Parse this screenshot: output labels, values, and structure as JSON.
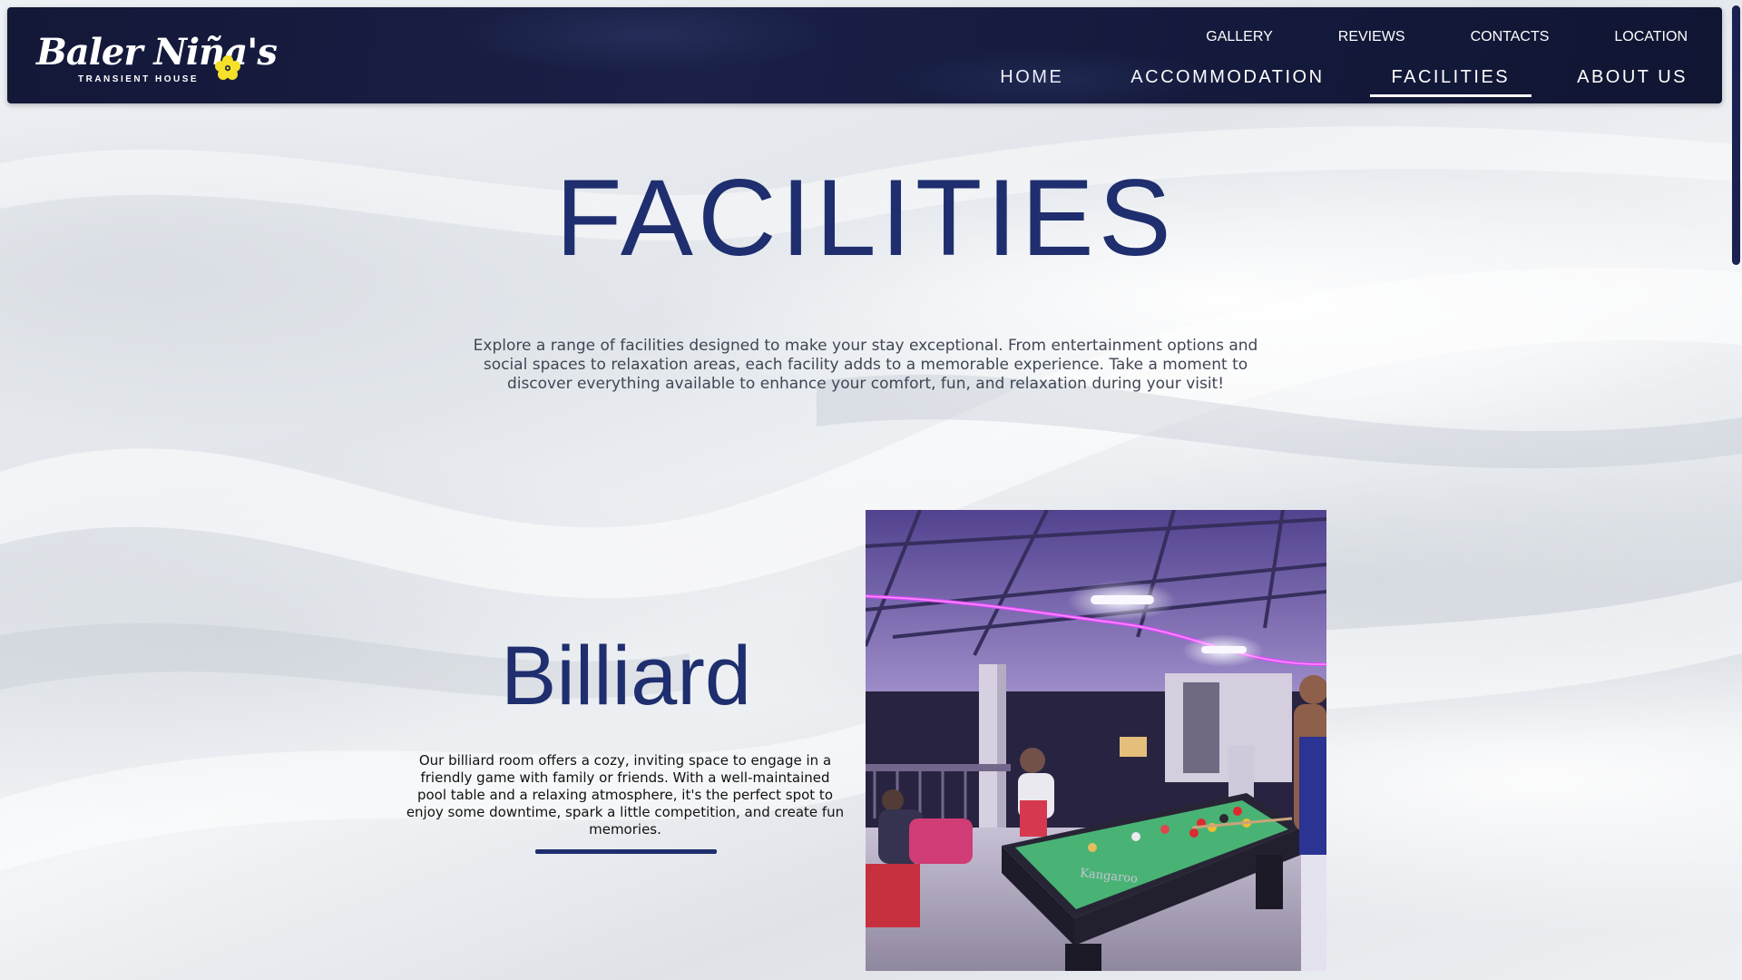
{
  "brand": {
    "name": "Baler Niña's",
    "tagline": "TRANSIENT HOUSE"
  },
  "nav": {
    "top": [
      "GALLERY",
      "REVIEWS",
      "CONTACTS",
      "LOCATION"
    ],
    "main": [
      "HOME",
      "ACCOMMODATION",
      "FACILITIES",
      "ABOUT US"
    ],
    "active": "FACILITIES"
  },
  "page": {
    "title": "FACILITIES",
    "intro": "Explore a range of facilities designed to make your stay exceptional. From entertainment options and social spaces to relaxation areas, each facility adds to a memorable experience. Take a moment to discover everything available to enhance your comfort, fun, and relaxation during your visit!"
  },
  "facility": {
    "title": "Billiard",
    "description": "Our billiard room offers a cozy, inviting space to engage in a friendly game with family or friends. With a well-maintained pool table and a relaxing atmosphere, it's the perfect spot to enjoy some downtime, spark a little competition, and create fun memories.",
    "table_brand": "Kangaroo"
  },
  "colors": {
    "header_bg": "#141a3c",
    "accent": "#1e2e6e",
    "flower": "#f5e02a"
  }
}
